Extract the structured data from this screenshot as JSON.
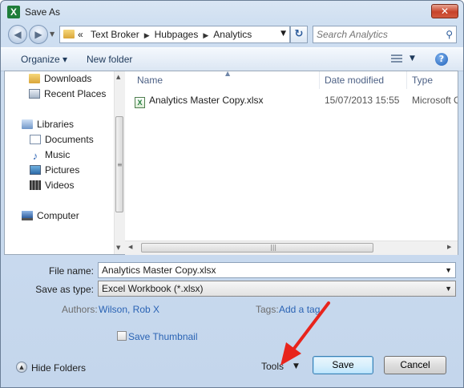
{
  "window": {
    "title": "Save As",
    "close_glyph": "✕"
  },
  "address": {
    "prefix": "«",
    "crumbs": [
      "Text Broker",
      "Hubpages",
      "Analytics"
    ],
    "search_placeholder": "Search Analytics"
  },
  "toolbar": {
    "organize_label": "Organize ▾",
    "new_folder_label": "New folder"
  },
  "nav": {
    "items": [
      {
        "label": "Downloads",
        "icon": "folder-icon"
      },
      {
        "label": "Recent Places",
        "icon": "recent-places-icon"
      },
      {
        "label": "Libraries",
        "icon": "libraries-icon"
      },
      {
        "label": "Documents",
        "icon": "documents-icon"
      },
      {
        "label": "Music",
        "icon": "music-icon"
      },
      {
        "label": "Pictures",
        "icon": "pictures-icon"
      },
      {
        "label": "Videos",
        "icon": "videos-icon"
      },
      {
        "label": "Computer",
        "icon": "computer-icon"
      }
    ]
  },
  "files": {
    "columns": [
      "Name",
      "Date modified",
      "Type"
    ],
    "rows": [
      {
        "name": "Analytics Master Copy.xlsx",
        "date": "15/07/2013 15:55",
        "type": "Microsoft Office"
      }
    ]
  },
  "form": {
    "filename_label": "File name:",
    "filename_value": "Analytics Master Copy.xlsx",
    "savetype_label": "Save as type:",
    "savetype_value": "Excel Workbook (*.xlsx)",
    "authors_label": "Authors:",
    "authors_value": "Wilson, Rob X",
    "tags_label": "Tags:",
    "tags_value": "Add a tag",
    "thumbnail_label": "Save Thumbnail"
  },
  "footer": {
    "hide_folders_label": "Hide Folders",
    "tools_label": "Tools",
    "save_label": "Save",
    "cancel_label": "Cancel"
  },
  "colors": {
    "annotation_arrow": "#e8241c",
    "link": "#2a63b4"
  }
}
